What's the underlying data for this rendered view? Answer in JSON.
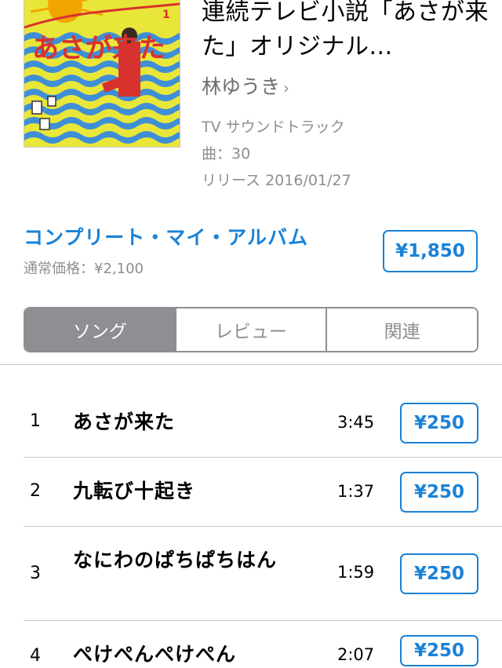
{
  "album": {
    "title": "連続テレビ小説「あさが来た」オリジナル...",
    "artist": "林ゆうき",
    "artist_chevron": "›",
    "genre": "TV サウンドトラック",
    "tracks_count": "曲：30",
    "release": "リリース 2016/01/27",
    "artwork_text": "あさが来た",
    "artwork_number": "1"
  },
  "purchase": {
    "complete_label": "コンプリート・マイ・アルバム",
    "regular_price": "通常価格：¥2,100",
    "album_price": "¥1,850"
  },
  "tabs": [
    {
      "label": "ソング",
      "active": true
    },
    {
      "label": "レビュー",
      "active": false
    },
    {
      "label": "関連",
      "active": false
    }
  ],
  "tracks": [
    {
      "num": "1",
      "title": "あさが来た",
      "duration": "3:45",
      "price": "¥250"
    },
    {
      "num": "2",
      "title": "九転び十起き",
      "duration": "1:37",
      "price": "¥250"
    },
    {
      "num": "3",
      "title": "なにわのぱちぱちはん",
      "duration": "1:59",
      "price": "¥250"
    },
    {
      "num": "4",
      "title": "ぺけぺんぺけぺん",
      "duration": "2:07",
      "price": "¥250"
    }
  ],
  "colors": {
    "accent": "#1a82d6",
    "muted": "#8e8e93",
    "artwork_yellow": "#e9e63a",
    "artwork_blue": "#3f8fd6",
    "artwork_red": "#d8322f"
  }
}
